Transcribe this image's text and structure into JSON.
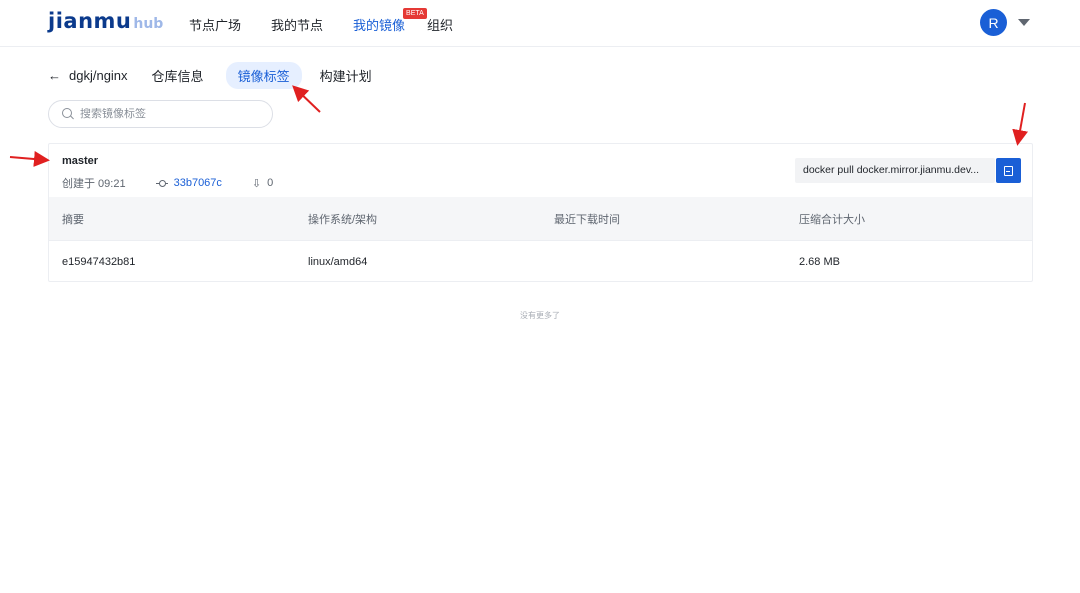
{
  "logo": {
    "main": "jianmu",
    "sub": "hub"
  },
  "nav": {
    "items": [
      {
        "label": "节点广场"
      },
      {
        "label": "我的节点"
      },
      {
        "label": "我的镜像",
        "badge": "BETA"
      },
      {
        "label": "组织"
      }
    ]
  },
  "user": {
    "avatar_letter": "R"
  },
  "repo": {
    "name": "dgkj/nginx"
  },
  "tabs": [
    {
      "label": "仓库信息"
    },
    {
      "label": "镜像标签"
    },
    {
      "label": "构建计划"
    }
  ],
  "search": {
    "placeholder": "搜索镜像标签"
  },
  "tag": {
    "name": "master",
    "created": "创建于 09:21",
    "commit": "33b7067c",
    "downloads": "0",
    "pull_command": "docker pull docker.mirror.jianmu.dev..."
  },
  "table": {
    "headers": [
      "摘要",
      "操作系统/架构",
      "最近下载时间",
      "压缩合计大小"
    ],
    "rows": [
      [
        "e15947432b81",
        "linux/amd64",
        "",
        "2.68 MB"
      ]
    ]
  },
  "footer": {
    "no_more": "没有更多了"
  },
  "colors": {
    "accent": "#1a5fd6",
    "beta": "#e53935",
    "annotation": "#e02020"
  }
}
